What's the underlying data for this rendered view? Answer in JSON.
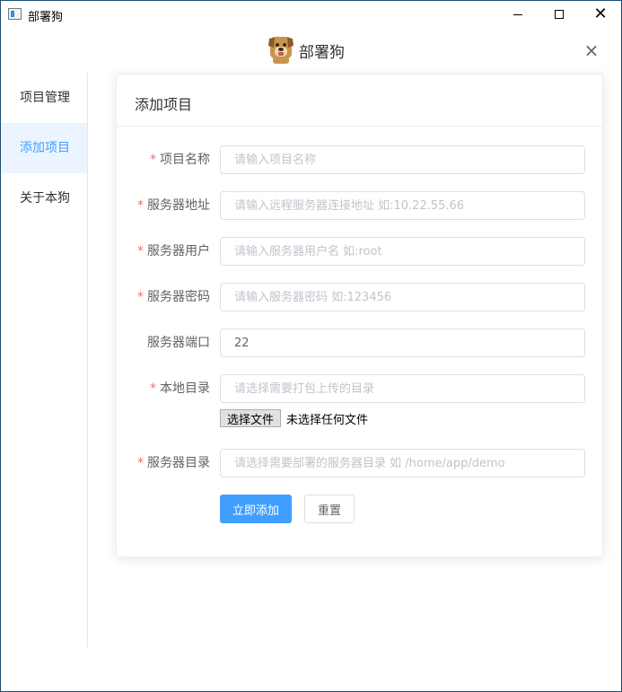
{
  "window": {
    "title": "部署狗"
  },
  "header": {
    "app_name": "部署狗",
    "close_symbol": "×"
  },
  "sidebar": {
    "items": [
      {
        "label": "项目管理",
        "active": false
      },
      {
        "label": "添加项目",
        "active": true
      },
      {
        "label": "关于本狗",
        "active": false
      }
    ]
  },
  "card": {
    "title": "添加项目"
  },
  "form": {
    "required_mark": "*",
    "project_name": {
      "label": "项目名称",
      "value": "",
      "placeholder": "请输入项目名称",
      "required": true
    },
    "server_address": {
      "label": "服务器地址",
      "value": "",
      "placeholder": "请输入远程服务器连接地址 如:10.22.55.66",
      "required": true
    },
    "server_user": {
      "label": "服务器用户",
      "value": "",
      "placeholder": "请输入服务器用户名 如:root",
      "required": true
    },
    "server_password": {
      "label": "服务器密码",
      "value": "",
      "placeholder": "请输入服务器密码 如:123456",
      "required": true
    },
    "server_port": {
      "label": "服务器端口",
      "value": "22",
      "placeholder": "",
      "required": false
    },
    "local_dir": {
      "label": "本地目录",
      "value": "",
      "placeholder": "请选择需要打包上传的目录",
      "required": true,
      "file_button": "选择文件",
      "file_status": "未选择任何文件"
    },
    "server_dir": {
      "label": "服务器目录",
      "value": "",
      "placeholder": "请选择需要部署的服务器目录 如 /home/app/demo",
      "required": true
    }
  },
  "actions": {
    "submit": "立即添加",
    "reset": "重置"
  },
  "colors": {
    "primary": "#409eff",
    "required": "#f56c6c",
    "active_bg": "#ecf5ff"
  }
}
